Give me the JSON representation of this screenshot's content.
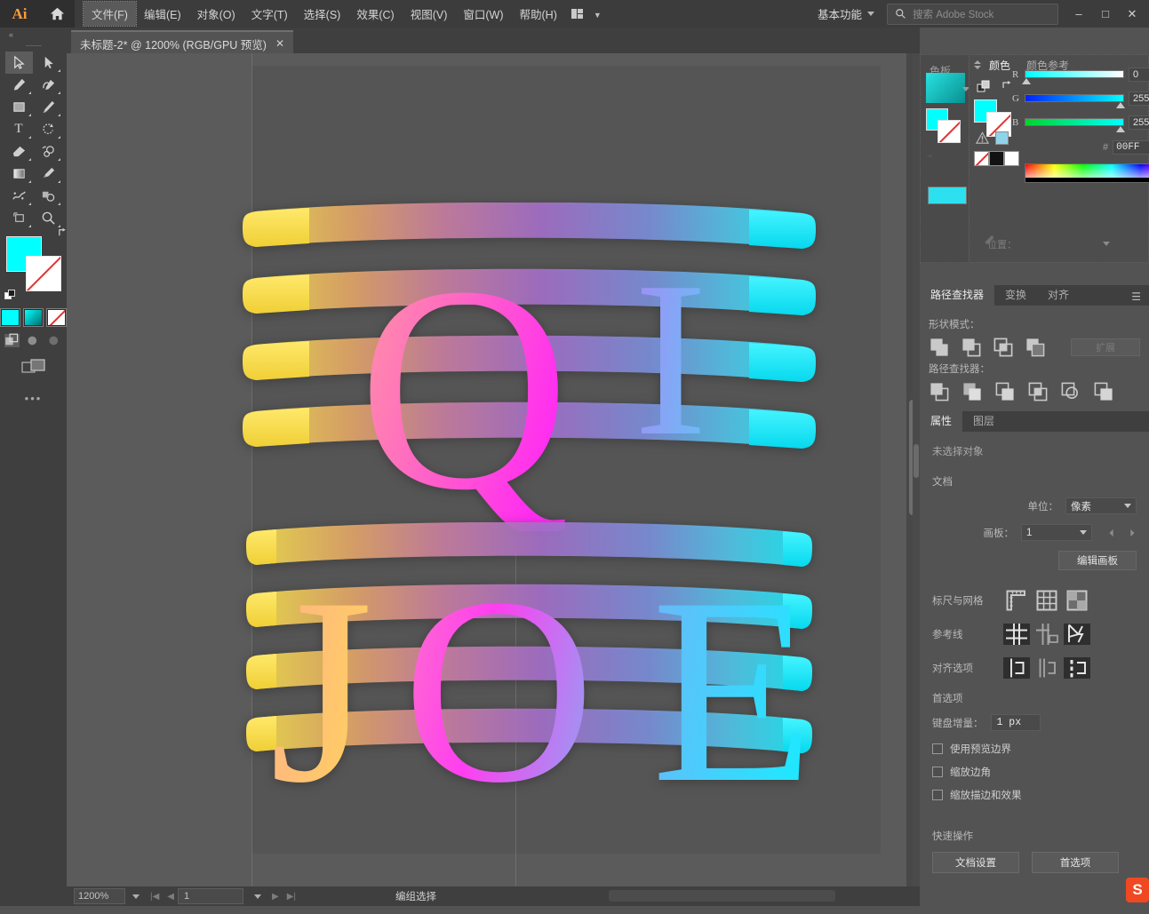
{
  "app": {
    "logo": "Ai",
    "home_icon": "home-icon"
  },
  "menu": {
    "items": [
      {
        "label": "文件(F)",
        "active": true
      },
      {
        "label": "编辑(E)",
        "active": false
      },
      {
        "label": "对象(O)",
        "active": false
      },
      {
        "label": "文字(T)",
        "active": false
      },
      {
        "label": "选择(S)",
        "active": false
      },
      {
        "label": "效果(C)",
        "active": false
      },
      {
        "label": "视图(V)",
        "active": false
      },
      {
        "label": "窗口(W)",
        "active": false
      },
      {
        "label": "帮助(H)",
        "active": false
      }
    ],
    "workspace": "基本功能",
    "search_placeholder": "搜索 Adobe Stock",
    "window_minimize": "–",
    "window_maximize": "□",
    "window_close": "✕"
  },
  "tab": {
    "title": "未标题-2* @ 1200% (RGB/GPU 预览)",
    "close": "✕",
    "overflow": "»"
  },
  "toolbar": {
    "collapse": "«",
    "more": "•••",
    "tools": [
      {
        "name": "selection-tool",
        "selected": true
      },
      {
        "name": "direct-selection-tool",
        "selected": false
      },
      {
        "name": "pen-tool",
        "selected": false
      },
      {
        "name": "curvature-tool",
        "selected": false
      },
      {
        "name": "rectangle-tool",
        "selected": false
      },
      {
        "name": "paintbrush-tool",
        "selected": false
      },
      {
        "name": "type-tool",
        "selected": false,
        "glyph": "T"
      },
      {
        "name": "rotate-tool",
        "selected": false
      },
      {
        "name": "eraser-tool",
        "selected": false
      },
      {
        "name": "width-tool",
        "selected": false
      },
      {
        "name": "gradient-tool",
        "selected": false
      },
      {
        "name": "eyedropper-tool",
        "selected": false
      },
      {
        "name": "symbol-sprayer-tool",
        "selected": false
      },
      {
        "name": "shape-builder-tool",
        "selected": false
      },
      {
        "name": "artboard-tool",
        "selected": false
      },
      {
        "name": "zoom-tool",
        "selected": false
      }
    ],
    "fill_color": "#00FFFF",
    "stroke_color": "none"
  },
  "canvas": {
    "artwork_top_letters": "QI",
    "artwork_bottom_letters": "JOE",
    "ribbon_gradient": [
      "#f5e04a",
      "#f78fa7",
      "#ff4fe0",
      "#9b6fe8",
      "#4fd8ff",
      "#00f0ff"
    ]
  },
  "swatches_panel": {
    "tab": "色板"
  },
  "color_panel": {
    "tabs": [
      {
        "label": "颜色",
        "active": true
      },
      {
        "label": "颜色参考",
        "active": false
      }
    ],
    "sliders": [
      {
        "label": "R",
        "value": "0"
      },
      {
        "label": "G",
        "value": "255"
      },
      {
        "label": "B",
        "value": "255"
      }
    ],
    "hash": "#",
    "hex": "00FF",
    "fill": "#00FFFF"
  },
  "pathfinder_panel": {
    "tabs": [
      {
        "label": "路径查找器",
        "active": true
      },
      {
        "label": "变换",
        "active": false
      },
      {
        "label": "对齐",
        "active": false
      }
    ],
    "menu_icon": "hamburger-icon",
    "shape_modes_label": "形状模式：",
    "expand_label": "扩展",
    "pathfinders_label": "路径查找器：",
    "shape_mode_buttons": [
      "unite",
      "minus-front",
      "intersect",
      "exclude"
    ],
    "pathfinder_buttons": [
      "divide",
      "trim",
      "merge",
      "crop",
      "outline",
      "minus-back"
    ]
  },
  "properties_panel": {
    "tabs": [
      {
        "label": "属性",
        "active": true
      },
      {
        "label": "图层",
        "active": false
      }
    ],
    "no_selection": "未选择对象",
    "document_label": "文档",
    "units_label": "单位：",
    "units_value": "像素",
    "artboard_label": "画板：",
    "artboard_value": "1",
    "edit_artboards": "编辑画板",
    "rulers_grids_label": "标尺与网格",
    "guides_label": "参考线",
    "align_options_label": "对齐选项",
    "preferences_label": "首选项",
    "keyboard_increment_label": "键盘增量：",
    "keyboard_increment_value": "1 px",
    "checkboxes": [
      {
        "label": "使用预览边界",
        "checked": false
      },
      {
        "label": "缩放边角",
        "checked": false
      },
      {
        "label": "缩放描边和效果",
        "checked": false
      }
    ],
    "quick_actions_label": "快速操作",
    "quick_actions": [
      {
        "label": "文档设置"
      },
      {
        "label": "首选项"
      }
    ]
  },
  "statusbar": {
    "zoom": "1200%",
    "page": "1",
    "status": "编组选择",
    "nav_first": "|◀",
    "nav_prev": "◀",
    "nav_next": "▶",
    "nav_last": "▶|",
    "right_arrow": "▶",
    "right_chevron": "‹"
  },
  "colors": {
    "accent_cyan": "#00FFFF",
    "chrome_bg": "#535353",
    "panel_bg": "#3F3F3F",
    "canvas_bg": "#5B5B5B"
  }
}
